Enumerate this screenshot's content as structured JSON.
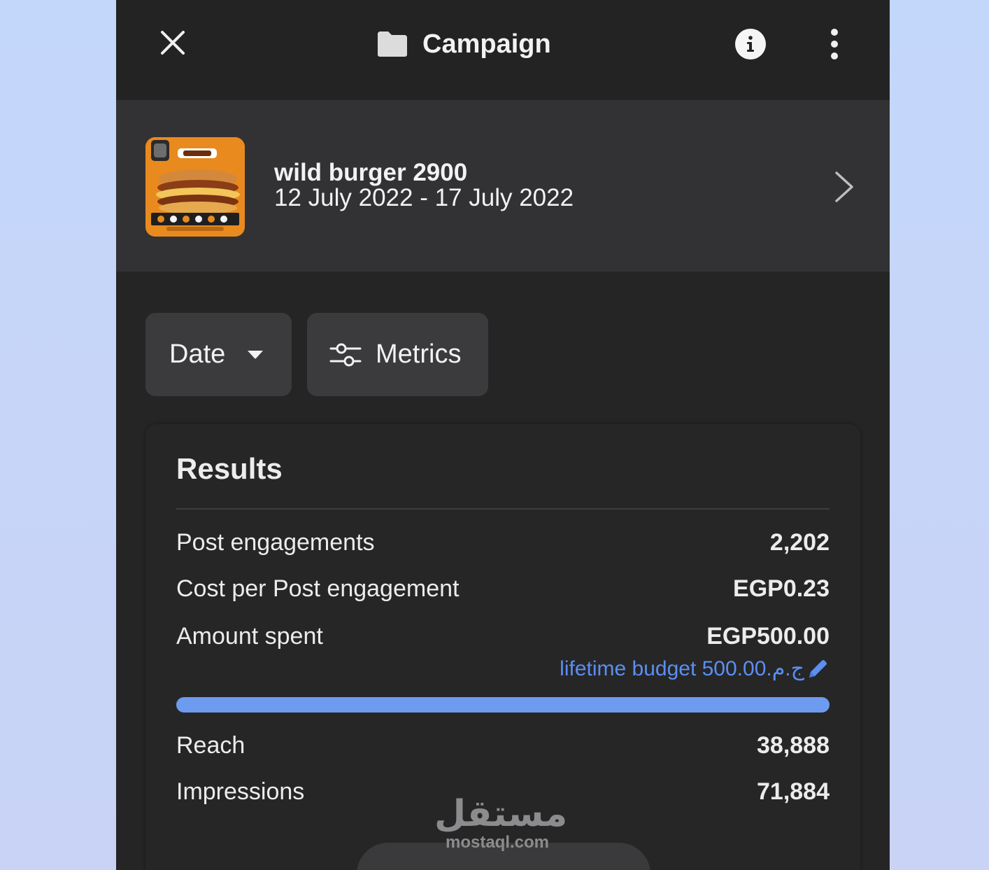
{
  "header": {
    "title": "Campaign",
    "close_icon": "close-icon",
    "folder_icon": "folder-icon",
    "info_icon": "info-icon",
    "more_icon": "more-vertical-icon"
  },
  "campaign": {
    "name": "wild burger 2900",
    "dates": "12 July 2022 - 17 July 2022",
    "thumbnail_color": "#e98a1e"
  },
  "filters": {
    "date_label": "Date",
    "metrics_label": "Metrics"
  },
  "results": {
    "title": "Results",
    "rows_top": [
      {
        "label": "Post engagements",
        "value": "2,202"
      },
      {
        "label": "Cost per Post engagement",
        "value": "EGP0.23"
      },
      {
        "label": "Amount spent",
        "value": "EGP500.00"
      }
    ],
    "budget_text": "lifetime budget 500.00.ج.م",
    "budget_progress": 1.0,
    "rows_bottom": [
      {
        "label": "Reach",
        "value": "38,888"
      },
      {
        "label": "Impressions",
        "value": "71,884"
      }
    ]
  },
  "watermark": {
    "arabic": "مستقل",
    "latin": "mostaql.com"
  },
  "colors": {
    "accent_blue": "#5b8ff0",
    "progress_blue": "#6c9bf0",
    "background": "#252526"
  }
}
